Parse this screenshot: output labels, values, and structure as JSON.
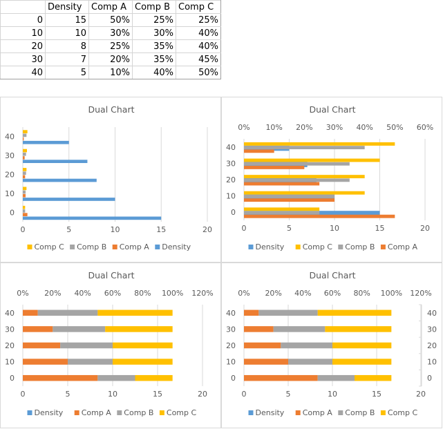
{
  "table": {
    "headers": [
      "",
      "Density",
      "Comp A",
      "Comp B",
      "Comp C"
    ],
    "rows": [
      [
        "0",
        "15",
        "50%",
        "25%",
        "25%"
      ],
      [
        "10",
        "10",
        "30%",
        "30%",
        "40%"
      ],
      [
        "20",
        "8",
        "25%",
        "35%",
        "40%"
      ],
      [
        "30",
        "7",
        "20%",
        "35%",
        "45%"
      ],
      [
        "40",
        "5",
        "10%",
        "40%",
        "50%"
      ]
    ]
  },
  "colors": {
    "Density": "#5b9bd5",
    "Comp A": "#ed7d31",
    "Comp B": "#a5a5a5",
    "Comp C": "#ffc000"
  },
  "chart_data": [
    {
      "type": "bar",
      "orientation": "horizontal",
      "title": "Dual Chart",
      "categories": [
        "0",
        "10",
        "20",
        "30",
        "40"
      ],
      "series": [
        {
          "name": "Density",
          "values": [
            15,
            10,
            8,
            7,
            5
          ],
          "axis": "primary"
        },
        {
          "name": "Comp A",
          "values": [
            0.5,
            0.3,
            0.25,
            0.2,
            0.1
          ],
          "axis": "primary"
        },
        {
          "name": "Comp B",
          "values": [
            0.25,
            0.3,
            0.35,
            0.35,
            0.4
          ],
          "axis": "primary"
        },
        {
          "name": "Comp C",
          "values": [
            0.25,
            0.4,
            0.4,
            0.45,
            0.5
          ],
          "axis": "primary"
        }
      ],
      "x_axis": {
        "range": [
          0,
          20
        ],
        "ticks": [
          "0",
          "5",
          "10",
          "15",
          "20"
        ]
      },
      "legend": {
        "position": "bottom",
        "order": [
          "Comp C",
          "Comp B",
          "Comp A",
          "Density"
        ]
      },
      "grid": true
    },
    {
      "type": "bar",
      "orientation": "horizontal",
      "title": "Dual Chart",
      "categories": [
        "0",
        "10",
        "20",
        "30",
        "40"
      ],
      "series": [
        {
          "name": "Density",
          "values": [
            15,
            10,
            8,
            7,
            5
          ],
          "axis": "primary"
        },
        {
          "name": "Comp A",
          "values": [
            0.5,
            0.3,
            0.25,
            0.2,
            0.1
          ],
          "axis": "secondary"
        },
        {
          "name": "Comp B",
          "values": [
            0.25,
            0.3,
            0.35,
            0.35,
            0.4
          ],
          "axis": "secondary"
        },
        {
          "name": "Comp C",
          "values": [
            0.25,
            0.4,
            0.4,
            0.45,
            0.5
          ],
          "axis": "secondary"
        }
      ],
      "x_axis": {
        "range": [
          0,
          20
        ],
        "ticks": [
          "0",
          "5",
          "10",
          "15",
          "20"
        ]
      },
      "x2_axis": {
        "range": [
          0,
          0.6
        ],
        "ticks": [
          "0%",
          "10%",
          "20%",
          "30%",
          "40%",
          "50%",
          "60%"
        ]
      },
      "legend": {
        "position": "bottom",
        "order": [
          "Density",
          "Comp C",
          "Comp B",
          "Comp A"
        ]
      },
      "grid": true
    },
    {
      "type": "bar",
      "orientation": "horizontal",
      "stacked": "percent-secondary",
      "title": "Dual Chart",
      "categories": [
        "0",
        "10",
        "20",
        "30",
        "40"
      ],
      "series": [
        {
          "name": "Density",
          "values": [
            15,
            10,
            8,
            7,
            5
          ],
          "axis": "primary",
          "hidden": true
        },
        {
          "name": "Comp A",
          "values": [
            0.5,
            0.3,
            0.25,
            0.2,
            0.1
          ],
          "axis": "secondary"
        },
        {
          "name": "Comp B",
          "values": [
            0.25,
            0.3,
            0.35,
            0.35,
            0.4
          ],
          "axis": "secondary"
        },
        {
          "name": "Comp C",
          "values": [
            0.25,
            0.4,
            0.4,
            0.45,
            0.5
          ],
          "axis": "secondary"
        }
      ],
      "x_axis": {
        "range": [
          0,
          20
        ],
        "ticks": [
          "0",
          "5",
          "10",
          "15",
          "20"
        ]
      },
      "x2_axis": {
        "range": [
          0,
          1.2
        ],
        "ticks": [
          "0%",
          "20%",
          "40%",
          "60%",
          "80%",
          "100%",
          "120%"
        ]
      },
      "legend": {
        "position": "bottom",
        "order": [
          "Density",
          "Comp A",
          "Comp B",
          "Comp C"
        ]
      },
      "grid": true
    },
    {
      "type": "bar",
      "orientation": "horizontal",
      "stacked": "percent-secondary",
      "title": "Dual Chart",
      "categories": [
        "0",
        "10",
        "20",
        "30",
        "40"
      ],
      "series": [
        {
          "name": "Density",
          "values": [
            15,
            10,
            8,
            7,
            5
          ],
          "axis": "primary",
          "hidden": true
        },
        {
          "name": "Comp A",
          "values": [
            0.5,
            0.3,
            0.25,
            0.2,
            0.1
          ],
          "axis": "secondary"
        },
        {
          "name": "Comp B",
          "values": [
            0.25,
            0.3,
            0.35,
            0.35,
            0.4
          ],
          "axis": "secondary"
        },
        {
          "name": "Comp C",
          "values": [
            0.25,
            0.4,
            0.4,
            0.45,
            0.5
          ],
          "axis": "secondary"
        }
      ],
      "x_axis": {
        "range": [
          0,
          20
        ],
        "ticks": [
          "0",
          "5",
          "10",
          "15",
          "20"
        ]
      },
      "x2_axis": {
        "range": [
          0,
          1.2
        ],
        "ticks": [
          "0%",
          "20%",
          "40%",
          "60%",
          "80%",
          "100%",
          "120%"
        ]
      },
      "y2_axis": {
        "ticks": [
          "0",
          "10",
          "20",
          "30",
          "40"
        ]
      },
      "legend": {
        "position": "bottom",
        "order": [
          "Density",
          "Comp A",
          "Comp B",
          "Comp C"
        ]
      },
      "grid": true
    }
  ]
}
